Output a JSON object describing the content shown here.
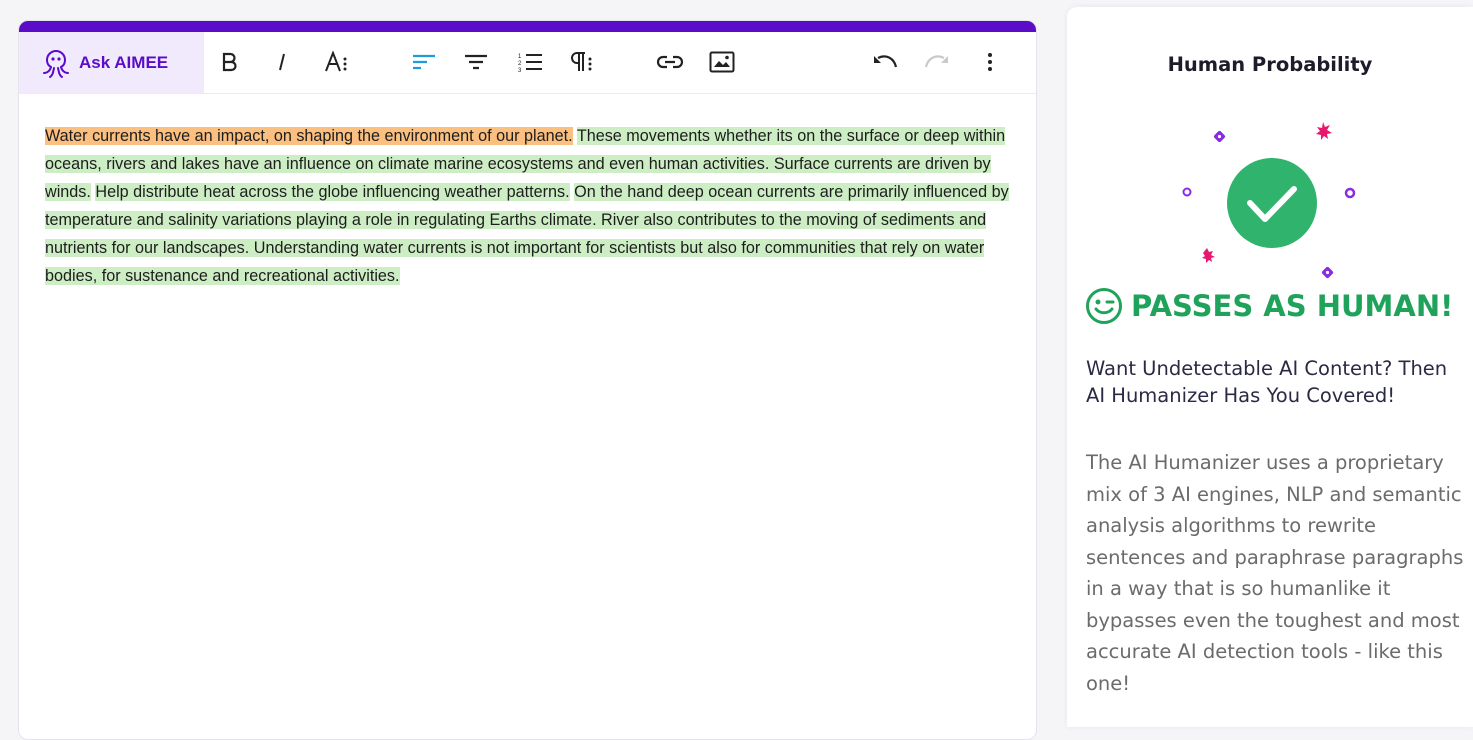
{
  "toolbar": {
    "ask_label": "Ask AIMEE",
    "icons": [
      "bold-icon",
      "italic-icon",
      "font-size-icon",
      "align-left-icon",
      "align-center-icon",
      "numbered-list-icon",
      "paragraph-icon",
      "link-icon",
      "image-icon",
      "undo-icon",
      "redo-icon",
      "more-icon"
    ],
    "active_color": "#1e9be0",
    "accent_color": "#5b0cc9"
  },
  "editor": {
    "segments": [
      {
        "text": "Water currents have an impact, on shaping the environment of our planet.",
        "highlight": "orange"
      },
      {
        "text": "These movements whether its on the surface or deep within oceans, rivers and lakes have an influence on climate marine ecosystems and even human activities. Surface currents are driven by winds.",
        "highlight": "green"
      },
      {
        "text": "Help distribute heat across the globe influencing weather patterns.",
        "highlight": "green"
      },
      {
        "text": "On the hand deep ocean currents are primarily influenced by temperature and salinity variations playing a role in regulating Earths climate. River also contributes to the moving of sediments and nutrients for our landscapes. Understanding water currents is not important for scientists but also for communities that rely on water bodies, for sustenance and recreational activities.",
        "highlight": "green"
      }
    ],
    "highlight_colors": {
      "orange": "#fbbf7f",
      "green": "#cdeec4"
    }
  },
  "side": {
    "title": "Human Probability",
    "verdict": "PASSES AS HUMAN!",
    "verdict_color": "#1fa35a",
    "promo_heading": "Want Undetectable AI Content? Then AI Humanizer Has You Covered!",
    "promo_body": "The AI Humanizer uses a proprietary mix of 3 AI engines, NLP and semantic analysis algorithms to rewrite sentences and paraphrase paragraphs in a way that is so humanlike it bypasses even the toughest and most accurate AI detection tools - like this one!"
  }
}
